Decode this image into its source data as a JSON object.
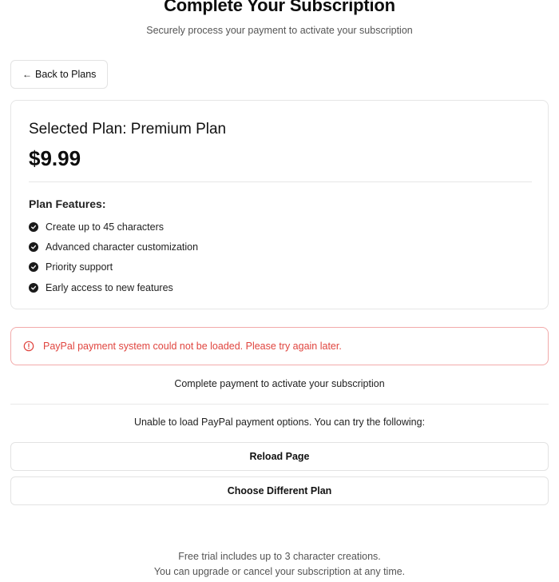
{
  "header": {
    "title": "Complete Your Subscription",
    "subtitle": "Securely process your payment to activate your subscription"
  },
  "back_button": {
    "arrow": "←",
    "label": "Back to Plans"
  },
  "plan": {
    "title": "Selected Plan: Premium Plan",
    "price": "$9.99",
    "features_heading": "Plan Features:",
    "features": [
      "Create up to 45 characters",
      "Advanced character customization",
      "Priority support",
      "Early access to new features"
    ],
    "feature_icon": "check-circle-icon"
  },
  "alert": {
    "icon": "alert-circle-icon",
    "message": "PayPal payment system could not be loaded. Please try again later.",
    "color": "#e0453f",
    "border_color": "#f2aaaa"
  },
  "payment": {
    "complete_text": "Complete payment to activate your subscription",
    "unable_text": "Unable to load PayPal payment options. You can try the following:",
    "reload_label": "Reload Page",
    "choose_label": "Choose Different Plan"
  },
  "footer": {
    "line1": "Free trial includes up to 3 character creations.",
    "line2": "You can upgrade or cancel your subscription at any time."
  }
}
